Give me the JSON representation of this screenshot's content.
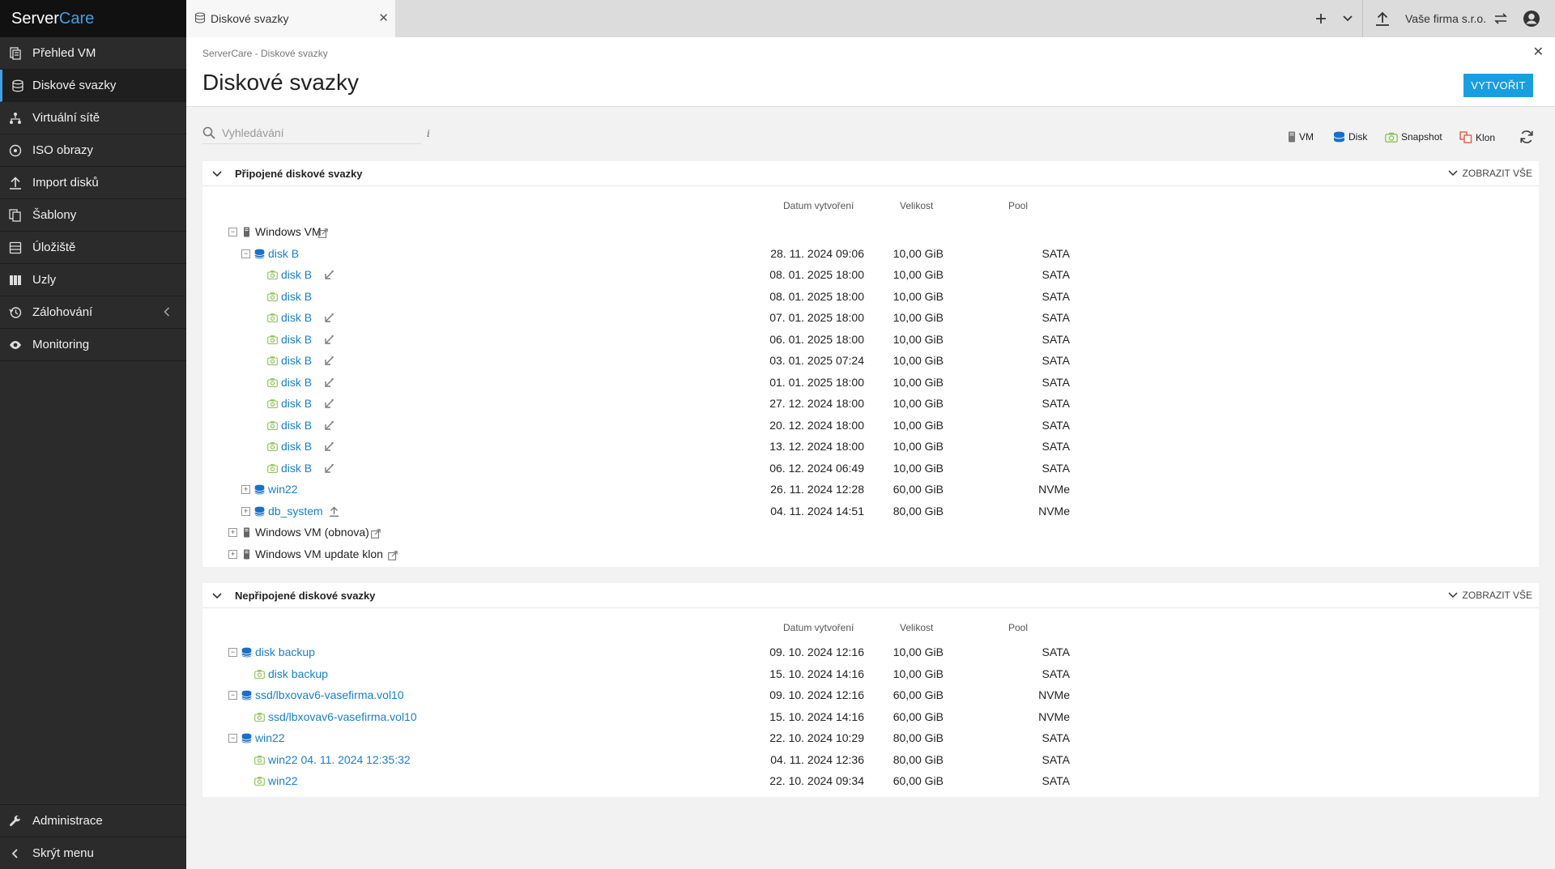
{
  "app": {
    "logo_left": "Server",
    "logo_right": "Care"
  },
  "sidebar": {
    "items": [
      {
        "label": "Přehled VM",
        "icon": "vm-list-icon"
      },
      {
        "label": "Diskové svazky",
        "icon": "database-icon",
        "active": true
      },
      {
        "label": "Virtuální sítě",
        "icon": "network-icon"
      },
      {
        "label": "ISO obrazy",
        "icon": "disc-icon"
      },
      {
        "label": "Import disků",
        "icon": "upload-icon"
      },
      {
        "label": "Šablony",
        "icon": "templates-icon"
      },
      {
        "label": "Úložiště",
        "icon": "storage-icon"
      },
      {
        "label": "Uzly",
        "icon": "nodes-icon"
      },
      {
        "label": "Zálohování",
        "icon": "history-icon"
      },
      {
        "label": "Monitoring",
        "icon": "eye-icon"
      }
    ],
    "bottom": [
      {
        "label": "Administrace",
        "icon": "wrench-icon"
      },
      {
        "label": "Skrýt menu",
        "icon": "chevron-left-icon"
      }
    ]
  },
  "topbar": {
    "tab_label": "Diskové svazky",
    "company": "Vaše firma s.r.o."
  },
  "header": {
    "breadcrumb": "ServerCare - Diskové svazky",
    "title": "Diskové svazky",
    "create_label": "VYTVOŘIT"
  },
  "search": {
    "placeholder": "Vyhledávání",
    "value": ""
  },
  "legend": {
    "vm": "VM",
    "disk": "Disk",
    "snapshot": "Snapshot",
    "clone": "Klon"
  },
  "colors": {
    "accent": "#1b9ee0",
    "link": "#1a7fc7",
    "snapshot": "#8cc152",
    "clone": "#e9573f",
    "sidebar": "#2b2b2b"
  },
  "columns": {
    "date": "Datum vytvoření",
    "size": "Velikost",
    "pool": "Pool"
  },
  "attached": {
    "title": "Připojené diskové svazky",
    "show_all": "ZOBRAZIT VŠE",
    "rows": [
      {
        "level": 0,
        "type": "vm",
        "toggle": "minus",
        "label": "Windows VM",
        "ext": true
      },
      {
        "level": 1,
        "type": "disk",
        "toggle": "minus",
        "label": "disk B",
        "date": "28. 11. 2024 09:06",
        "size": "10,00 GiB",
        "pool": "SATA"
      },
      {
        "level": 2,
        "type": "snapshot",
        "label": "disk B",
        "action": "rollback",
        "date": "08. 01. 2025 18:00",
        "size": "10,00 GiB",
        "pool": "SATA"
      },
      {
        "level": 2,
        "type": "snapshot",
        "label": "disk B",
        "date": "08. 01. 2025 18:00",
        "size": "10,00 GiB",
        "pool": "SATA"
      },
      {
        "level": 2,
        "type": "snapshot",
        "label": "disk B",
        "action": "rollback",
        "date": "07. 01. 2025 18:00",
        "size": "10,00 GiB",
        "pool": "SATA"
      },
      {
        "level": 2,
        "type": "snapshot",
        "label": "disk B",
        "action": "rollback",
        "date": "06. 01. 2025 18:00",
        "size": "10,00 GiB",
        "pool": "SATA"
      },
      {
        "level": 2,
        "type": "snapshot",
        "label": "disk B",
        "action": "rollback",
        "date": "03. 01. 2025 07:24",
        "size": "10,00 GiB",
        "pool": "SATA"
      },
      {
        "level": 2,
        "type": "snapshot",
        "label": "disk B",
        "action": "rollback",
        "date": "01. 01. 2025 18:00",
        "size": "10,00 GiB",
        "pool": "SATA"
      },
      {
        "level": 2,
        "type": "snapshot",
        "label": "disk B",
        "action": "rollback",
        "date": "27. 12. 2024 18:00",
        "size": "10,00 GiB",
        "pool": "SATA"
      },
      {
        "level": 2,
        "type": "snapshot",
        "label": "disk B",
        "action": "rollback",
        "date": "20. 12. 2024 18:00",
        "size": "10,00 GiB",
        "pool": "SATA"
      },
      {
        "level": 2,
        "type": "snapshot",
        "label": "disk B",
        "action": "rollback",
        "date": "13. 12. 2024 18:00",
        "size": "10,00 GiB",
        "pool": "SATA"
      },
      {
        "level": 2,
        "type": "snapshot",
        "label": "disk B",
        "action": "rollback",
        "date": "06. 12. 2024 06:49",
        "size": "10,00 GiB",
        "pool": "SATA"
      },
      {
        "level": 1,
        "type": "disk",
        "toggle": "plus",
        "label": "win22",
        "date": "26. 11. 2024 12:28",
        "size": "60,00 GiB",
        "pool": "NVMe"
      },
      {
        "level": 1,
        "type": "disk",
        "toggle": "plus",
        "label": "db_system",
        "action": "upload",
        "date": "04. 11. 2024 14:51",
        "size": "80,00 GiB",
        "pool": "NVMe"
      },
      {
        "level": 0,
        "type": "vm",
        "toggle": "plus",
        "label": "Windows VM (obnova)",
        "ext": true
      },
      {
        "level": 0,
        "type": "vm",
        "toggle": "plus",
        "label": "Windows VM update klon",
        "ext": true
      }
    ]
  },
  "detached": {
    "title": "Nepřipojené diskové svazky",
    "show_all": "ZOBRAZIT VŠE",
    "rows": [
      {
        "level": 0,
        "type": "disk",
        "toggle": "minus",
        "label": "disk backup",
        "date": "09. 10. 2024 12:16",
        "size": "10,00 GiB",
        "pool": "SATA"
      },
      {
        "level": 1,
        "type": "snapshot",
        "label": "disk backup",
        "date": "15. 10. 2024 14:16",
        "size": "10,00 GiB",
        "pool": "SATA"
      },
      {
        "level": 0,
        "type": "disk",
        "toggle": "minus",
        "label": "ssd/lbxovav6-vasefirma.vol10",
        "date": "09. 10. 2024 12:16",
        "size": "60,00 GiB",
        "pool": "NVMe"
      },
      {
        "level": 1,
        "type": "snapshot",
        "label": "ssd/lbxovav6-vasefirma.vol10",
        "date": "15. 10. 2024 14:16",
        "size": "60,00 GiB",
        "pool": "NVMe"
      },
      {
        "level": 0,
        "type": "disk",
        "toggle": "minus",
        "label": "win22",
        "date": "22. 10. 2024 10:29",
        "size": "80,00 GiB",
        "pool": "SATA"
      },
      {
        "level": 1,
        "type": "snapshot",
        "label": "win22 04. 11. 2024 12:35:32",
        "date": "04. 11. 2024 12:36",
        "size": "80,00 GiB",
        "pool": "SATA"
      },
      {
        "level": 1,
        "type": "snapshot",
        "label": "win22",
        "date": "22. 10. 2024 09:34",
        "size": "60,00 GiB",
        "pool": "SATA"
      }
    ]
  }
}
